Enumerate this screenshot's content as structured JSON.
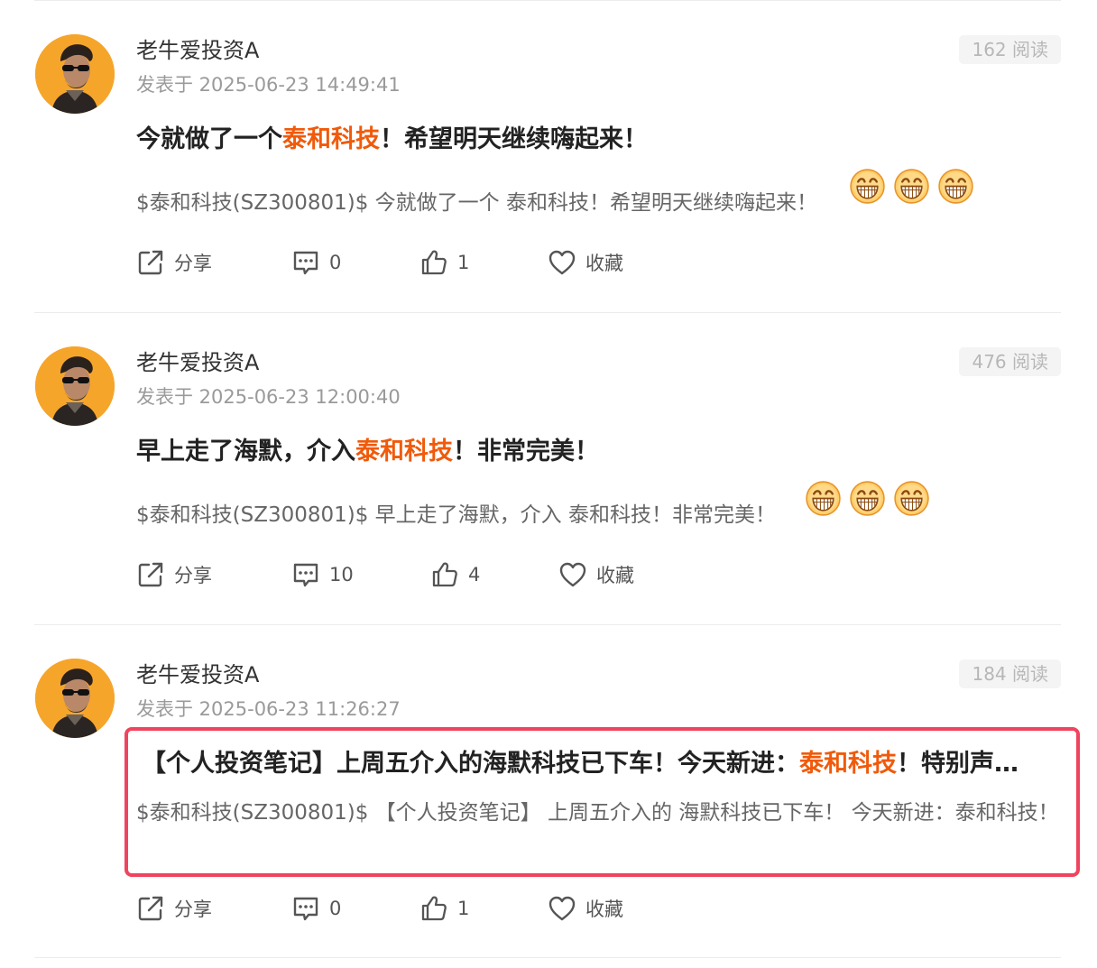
{
  "posts": [
    {
      "author": "老牛爱投资A",
      "time": "发表于 2025-06-23 14:49:41",
      "reads": "162 阅读",
      "title_before": "今就做了一个",
      "title_highlight": "泰和科技",
      "title_after": "！希望明天继续嗨起来！",
      "content": "$泰和科技(SZ300801)$ 今就做了一个 泰和科技！希望明天继续嗨起来！",
      "share_label": "分享",
      "comments": "0",
      "likes": "1",
      "favorite_label": "收藏"
    },
    {
      "author": "老牛爱投资A",
      "time": "发表于 2025-06-23 12:00:40",
      "reads": "476 阅读",
      "title_before": "早上走了海默，介入",
      "title_highlight": "泰和科技",
      "title_after": "！非常完美！",
      "content": "$泰和科技(SZ300801)$ 早上走了海默，介入 泰和科技！非常完美！",
      "share_label": "分享",
      "comments": "10",
      "likes": "4",
      "favorite_label": "收藏"
    },
    {
      "author": "老牛爱投资A",
      "time": "发表于 2025-06-23 11:26:27",
      "reads": "184 阅读",
      "title_before": "【个人投资笔记】上周五介入的海默科技已下车！今天新进：",
      "title_highlight": "泰和科技",
      "title_after": "！特别声…",
      "content": "$泰和科技(SZ300801)$ 【个人投资笔记】 上周五介入的 海默科技已下车！ 今天新进：泰和科技！",
      "share_label": "分享",
      "comments": "0",
      "likes": "1",
      "favorite_label": "收藏"
    }
  ],
  "colors": {
    "highlight": "#f05a0a",
    "box_border": "#f0445e",
    "avatar_bg": "#f6a52b"
  },
  "icons": [
    "share-icon",
    "comment-icon",
    "like-icon",
    "favorite-icon",
    "grinning-emoji-icon"
  ]
}
